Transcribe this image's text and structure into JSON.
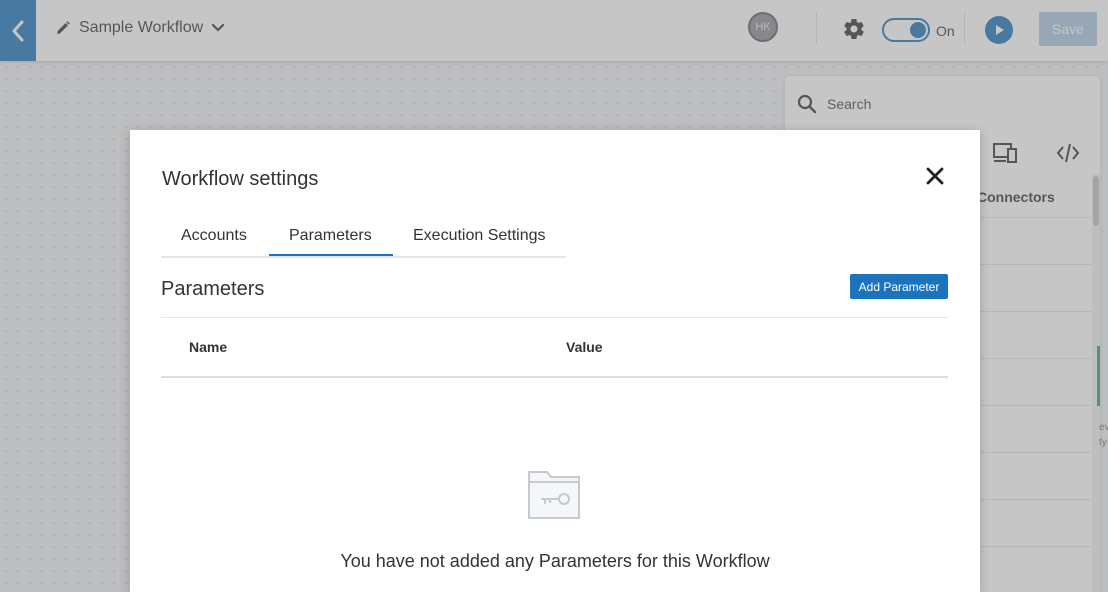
{
  "topbar": {
    "workflow_name": "Sample Workflow",
    "avatar_initials": "HK",
    "toggle_label": "On",
    "toggle_on": true,
    "save_label": "Save"
  },
  "side_panel": {
    "search_placeholder": "Search",
    "active_tab_label": "Connectors",
    "hint_1": "ev",
    "hint_2": "ty"
  },
  "modal": {
    "title": "Workflow settings",
    "tabs": [
      {
        "label": "Accounts",
        "active": false
      },
      {
        "label": "Parameters",
        "active": true
      },
      {
        "label": "Execution Settings",
        "active": false
      }
    ],
    "section_title": "Parameters",
    "add_button_label": "Add Parameter",
    "columns": [
      "Name",
      "Value"
    ],
    "empty_message": "You have not added any Parameters for this Workflow"
  },
  "colors": {
    "accent": "#1b74bb",
    "save_disabled": "#a9c7e0",
    "overlay": "rgba(128,128,128,0.45)"
  },
  "icons": [
    "chevron-left-icon",
    "pencil-icon",
    "chevron-down-icon",
    "gear-icon",
    "play-icon",
    "search-icon",
    "devices-icon",
    "code-icon",
    "close-icon",
    "folder-key-icon"
  ]
}
